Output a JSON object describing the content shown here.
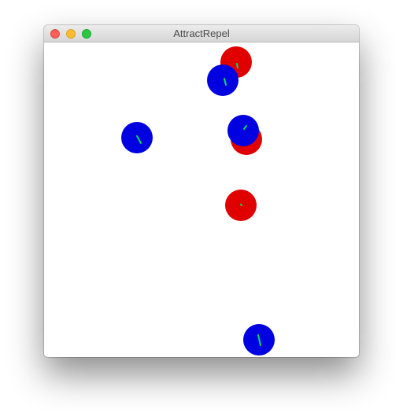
{
  "window": {
    "title": "AttractRepel",
    "buttons": [
      {
        "name": "close-button",
        "color": "#fc5f57",
        "border": "#de4a41"
      },
      {
        "name": "minimize-button",
        "color": "#fdbd2e",
        "border": "#dea022"
      },
      {
        "name": "zoom-button",
        "color": "#29c840",
        "border": "#1ea931"
      }
    ]
  },
  "sketch": {
    "background": "#ffffff",
    "heading_color": "#00e060",
    "particles": [
      {
        "kind": "red",
        "color": "#e00000"
      },
      {
        "kind": "blue",
        "color": "#0000e0"
      },
      {
        "kind": "blue",
        "color": "#0000e0"
      },
      {
        "kind": "red",
        "color": "#e00000"
      },
      {
        "kind": "blue",
        "color": "#0000e0"
      },
      {
        "kind": "red",
        "color": "#e00000"
      },
      {
        "kind": "blue",
        "color": "#0000e0"
      }
    ]
  }
}
